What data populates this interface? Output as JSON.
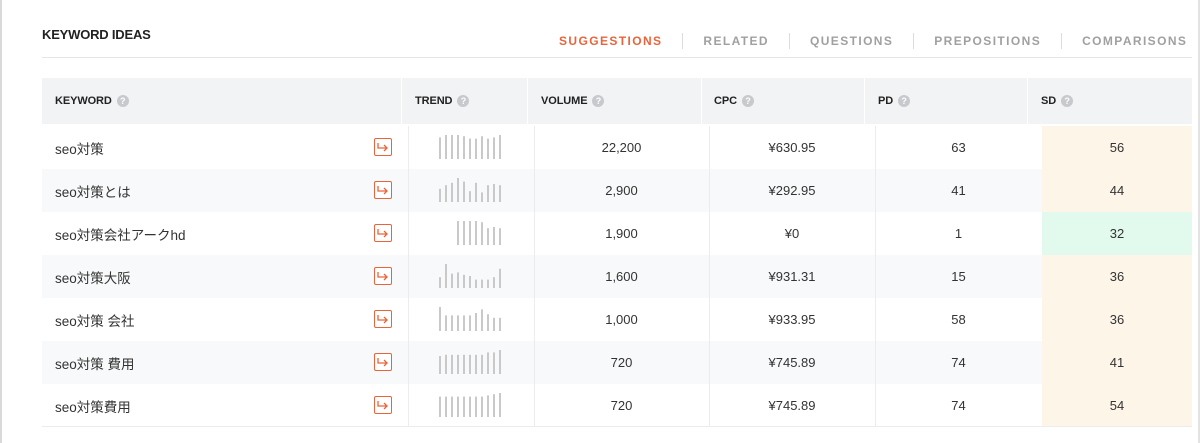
{
  "panel": {
    "title": "KEYWORD IDEAS"
  },
  "tabs": [
    {
      "label": "SUGGESTIONS",
      "active": true
    },
    {
      "label": "RELATED",
      "active": false
    },
    {
      "label": "QUESTIONS",
      "active": false
    },
    {
      "label": "PREPOSITIONS",
      "active": false
    },
    {
      "label": "COMPARISONS",
      "active": false
    }
  ],
  "columns": {
    "keyword": "KEYWORD",
    "trend": "TREND",
    "volume": "VOLUME",
    "cpc": "CPC",
    "pd": "PD",
    "sd": "SD"
  },
  "help_icon_glyph": "?",
  "colors": {
    "accent": "#e8643c",
    "sd_easy": "#e2f9ed",
    "sd_medium": "#fdf6e8",
    "trend_bar": "#c9c9c9"
  },
  "rows": [
    {
      "keyword": "seo対策",
      "volume": "22,200",
      "cpc": "¥630.95",
      "pd": "63",
      "sd": "56",
      "sd_level": "medium",
      "trend": [
        0.9,
        1,
        1,
        1,
        0.95,
        0.85,
        0.85,
        0.95,
        0.85,
        0.9,
        1
      ]
    },
    {
      "keyword": "seo対策とは",
      "volume": "2,900",
      "cpc": "¥292.95",
      "pd": "41",
      "sd": "44",
      "sd_level": "medium",
      "trend": [
        0.55,
        0.7,
        0.8,
        1,
        0.85,
        0.45,
        0.8,
        0.4,
        0.7,
        0.75,
        0.7
      ]
    },
    {
      "keyword": "seo対策会社アークhd",
      "volume": "1,900",
      "cpc": "¥0",
      "pd": "1",
      "sd": "32",
      "sd_level": "easy",
      "trend": [
        0,
        0,
        0,
        1,
        1,
        1,
        1,
        0.95,
        0.7,
        0.75,
        0.7
      ]
    },
    {
      "keyword": "seo対策大阪",
      "volume": "1,600",
      "cpc": "¥931.31",
      "pd": "15",
      "sd": "36",
      "sd_level": "medium",
      "trend": [
        0.45,
        1,
        0.6,
        0.65,
        0.55,
        0.5,
        0.35,
        0.35,
        0.35,
        0.45,
        0.8
      ]
    },
    {
      "keyword": "seo対策 会社",
      "volume": "1,000",
      "cpc": "¥933.95",
      "pd": "58",
      "sd": "36",
      "sd_level": "medium",
      "trend": [
        1,
        0.65,
        0.65,
        0.65,
        0.65,
        0.65,
        0.75,
        0.9,
        0.7,
        0.55,
        0.55
      ]
    },
    {
      "keyword": "seo対策 費用",
      "volume": "720",
      "cpc": "¥745.89",
      "pd": "74",
      "sd": "41",
      "sd_level": "medium",
      "trend": [
        0.75,
        0.8,
        0.8,
        0.8,
        0.8,
        0.8,
        0.8,
        0.8,
        0.9,
        0.9,
        1
      ]
    },
    {
      "keyword": "seo対策費用",
      "volume": "720",
      "cpc": "¥745.89",
      "pd": "74",
      "sd": "54",
      "sd_level": "medium",
      "trend": [
        0.85,
        0.85,
        0.85,
        0.85,
        0.85,
        0.85,
        0.85,
        0.85,
        0.9,
        0.95,
        1
      ]
    }
  ]
}
